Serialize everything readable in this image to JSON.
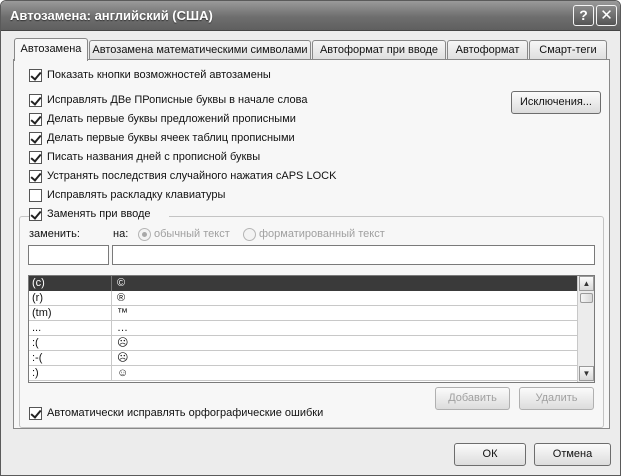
{
  "window": {
    "title": "Автозамена: английский (США)",
    "help_glyph": "?",
    "close_glyph": "✕"
  },
  "tabs": [
    {
      "label": "Автозамена",
      "active": true
    },
    {
      "label": "Автозамена математическими символами",
      "active": false
    },
    {
      "label": "Автоформат при вводе",
      "active": false
    },
    {
      "label": "Автоформат",
      "active": false
    },
    {
      "label": "Смарт-теги",
      "active": false
    }
  ],
  "options": {
    "show_buttons": {
      "label": "Показать кнопки возможностей автозамены",
      "checked": true
    },
    "two_caps": {
      "label": "Исправлять ДВе ПРописные буквы в начале слова",
      "checked": true
    },
    "sentence_caps": {
      "label": "Делать первые буквы предложений прописными",
      "checked": true
    },
    "table_caps": {
      "label": "Делать первые буквы ячеек таблиц прописными",
      "checked": true
    },
    "day_names": {
      "label": "Писать названия дней с прописной буквы",
      "checked": true
    },
    "caps_lock": {
      "label": "Устранять последствия случайного нажатия cAPS LOCK",
      "checked": true
    },
    "keyboard_layout": {
      "label": "Исправлять раскладку клавиатуры",
      "checked": false
    },
    "replace_typing": {
      "label": "Заменять при вводе",
      "checked": true
    },
    "auto_spell": {
      "label": "Автоматически исправлять орфографические ошибки",
      "checked": true
    }
  },
  "exceptions_button": "Исключения...",
  "replace_section": {
    "replace_label": "заменить:",
    "with_label": "на:",
    "plain_text": "обычный текст",
    "formatted_text": "форматированный текст",
    "replace_value": "",
    "with_value": ""
  },
  "list_rows": [
    {
      "from": "(c)",
      "to": "©",
      "selected": true
    },
    {
      "from": "(r)",
      "to": "®",
      "selected": false
    },
    {
      "from": "(tm)",
      "to": "™",
      "selected": false
    },
    {
      "from": "...",
      "to": "…",
      "selected": false
    },
    {
      "from": ":(",
      "to": "☹",
      "selected": false
    },
    {
      "from": ":-(",
      "to": "☹",
      "selected": false
    },
    {
      "from": ":)",
      "to": "☺",
      "selected": false
    }
  ],
  "scroll": {
    "up": "▲",
    "down": "▼"
  },
  "buttons": {
    "add": "Добавить",
    "delete": "Удалить",
    "ok": "ОК",
    "cancel": "Отмена"
  }
}
